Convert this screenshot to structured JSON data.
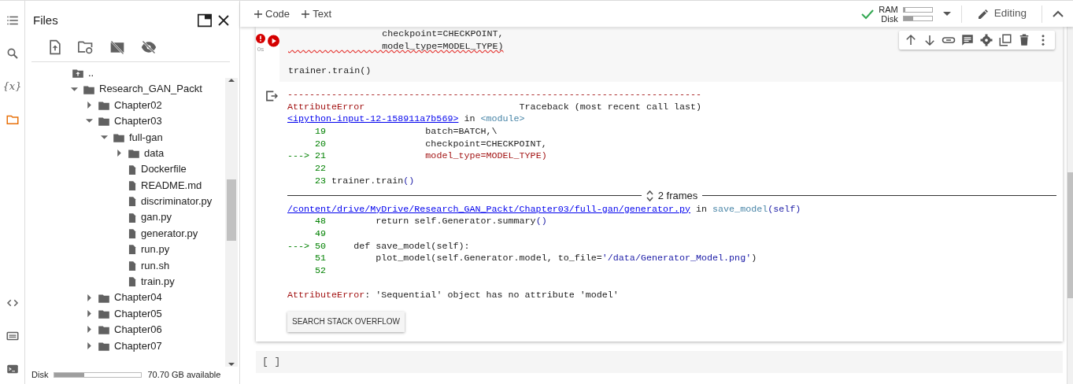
{
  "rail": {
    "top": [
      {
        "kind": "toc",
        "selected": false
      },
      {
        "kind": "search",
        "selected": false
      },
      {
        "kind": "variables",
        "label": "{x}",
        "selected": false
      },
      {
        "kind": "files",
        "selected": true
      }
    ],
    "bottom": [
      {
        "kind": "code",
        "selected": false
      },
      {
        "kind": "palette",
        "selected": false
      },
      {
        "kind": "terminal",
        "selected": false
      }
    ]
  },
  "files_panel": {
    "title": "Files",
    "tree": [
      {
        "kind": "up",
        "name": ".."
      },
      {
        "kind": "folder",
        "name": "Research_GAN_Packt",
        "expanded": true,
        "children": [
          {
            "kind": "folder",
            "name": "Chapter02",
            "expanded": false
          },
          {
            "kind": "folder",
            "name": "Chapter03",
            "expanded": true,
            "children": [
              {
                "kind": "folder",
                "name": "full-gan",
                "expanded": true,
                "children": [
                  {
                    "kind": "folder",
                    "name": "data",
                    "expanded": false
                  },
                  {
                    "kind": "file",
                    "name": "Dockerfile"
                  },
                  {
                    "kind": "file",
                    "name": "README.md"
                  },
                  {
                    "kind": "file",
                    "name": "discriminator.py"
                  },
                  {
                    "kind": "file",
                    "name": "gan.py"
                  },
                  {
                    "kind": "file",
                    "name": "generator.py"
                  },
                  {
                    "kind": "file",
                    "name": "run.py"
                  },
                  {
                    "kind": "file",
                    "name": "run.sh"
                  },
                  {
                    "kind": "file",
                    "name": "train.py"
                  }
                ]
              }
            ]
          },
          {
            "kind": "folder",
            "name": "Chapter04",
            "expanded": false
          },
          {
            "kind": "folder",
            "name": "Chapter05",
            "expanded": false
          },
          {
            "kind": "folder",
            "name": "Chapter06",
            "expanded": false
          },
          {
            "kind": "folder",
            "name": "Chapter07",
            "expanded": false
          }
        ]
      }
    ],
    "disk": {
      "label": "Disk",
      "level": 0.34,
      "available": "70.70 GB available"
    }
  },
  "toolbar": {
    "add_code": "Code",
    "add_text": "Text",
    "ram": {
      "label": "RAM",
      "level": 0.06
    },
    "disk": {
      "label": "Disk",
      "level": 0.35
    },
    "mode": "Editing"
  },
  "cell": {
    "status_time": "0s",
    "has_error": true,
    "code_lines": [
      {
        "kind": "code",
        "text": "                 checkpoint=CHECKPOINT,",
        "squiggle": false
      },
      {
        "kind": "code",
        "text": "                 model_type=MODEL_TYPE)",
        "squiggle": true
      },
      {
        "kind": "blank"
      },
      {
        "kind": "code",
        "text": "trainer.train()",
        "squiggle": false
      }
    ],
    "output": [
      {
        "kind": "line",
        "segments": [
          {
            "t": "---------------------------------------------------------------------------",
            "kind": "err"
          }
        ]
      },
      {
        "kind": "line",
        "segments": [
          {
            "t": "AttributeError",
            "kind": "err"
          },
          {
            "t": "                            Traceback (most recent call last)",
            "kind": "plain"
          }
        ]
      },
      {
        "kind": "line",
        "segments": [
          {
            "t": "<ipython-input-12-158911a7b569>",
            "kind": "link"
          },
          {
            "t": " in ",
            "kind": "plain"
          },
          {
            "t": "<module>",
            "kind": "muted"
          }
        ]
      },
      {
        "kind": "line",
        "segments": [
          {
            "t": "     19",
            "kind": "num"
          },
          {
            "t": "                  batch=BATCH,\\",
            "kind": "plain"
          }
        ]
      },
      {
        "kind": "line",
        "segments": [
          {
            "t": "     20",
            "kind": "num"
          },
          {
            "t": "                  checkpoint=CHECKPOINT,",
            "kind": "plain"
          }
        ]
      },
      {
        "kind": "line",
        "segments": [
          {
            "t": "---> 21",
            "kind": "num"
          },
          {
            "t": "                  model_type=MODEL_TYPE)",
            "kind": "err"
          }
        ]
      },
      {
        "kind": "line",
        "segments": [
          {
            "t": "     22",
            "kind": "num"
          }
        ]
      },
      {
        "kind": "line",
        "segments": [
          {
            "t": "     23",
            "kind": "num"
          },
          {
            "t": " trainer.train",
            "kind": "plain"
          },
          {
            "t": "()",
            "kind": "paren"
          }
        ]
      },
      {
        "kind": "frames",
        "text": "2 frames"
      },
      {
        "kind": "line",
        "segments": [
          {
            "t": "/content/drive/MyDrive/Research_GAN_Packt/Chapter03/full-gan/generator.py",
            "kind": "link"
          },
          {
            "t": " in ",
            "kind": "plain"
          },
          {
            "t": "save_model",
            "kind": "muted"
          },
          {
            "t": "(self)",
            "kind": "paren"
          }
        ]
      },
      {
        "kind": "line",
        "segments": [
          {
            "t": "     48",
            "kind": "num"
          },
          {
            "t": "         return self.Generator.summary",
            "kind": "plain"
          },
          {
            "t": "()",
            "kind": "paren"
          }
        ]
      },
      {
        "kind": "line",
        "segments": [
          {
            "t": "     49",
            "kind": "num"
          }
        ]
      },
      {
        "kind": "line",
        "segments": [
          {
            "t": "---> 50",
            "kind": "num"
          },
          {
            "t": "     def save_model(self):",
            "kind": "plain"
          }
        ]
      },
      {
        "kind": "line",
        "segments": [
          {
            "t": "     51",
            "kind": "num"
          },
          {
            "t": "         plot_model(self.Generator.model, to_file=",
            "kind": "plain"
          },
          {
            "t": "'/data/Generator_Model.png'",
            "kind": "str"
          },
          {
            "t": ")",
            "kind": "plain"
          }
        ]
      },
      {
        "kind": "line",
        "segments": [
          {
            "t": "     52",
            "kind": "num"
          }
        ]
      },
      {
        "kind": "blank"
      },
      {
        "kind": "line",
        "segments": [
          {
            "t": "AttributeError",
            "kind": "err"
          },
          {
            "t": ": 'Sequential' object has no attribute 'model'",
            "kind": "plain"
          }
        ]
      }
    ],
    "search_button": "SEARCH STACK OVERFLOW"
  },
  "next_cell": {
    "prompt": "[ ]"
  }
}
